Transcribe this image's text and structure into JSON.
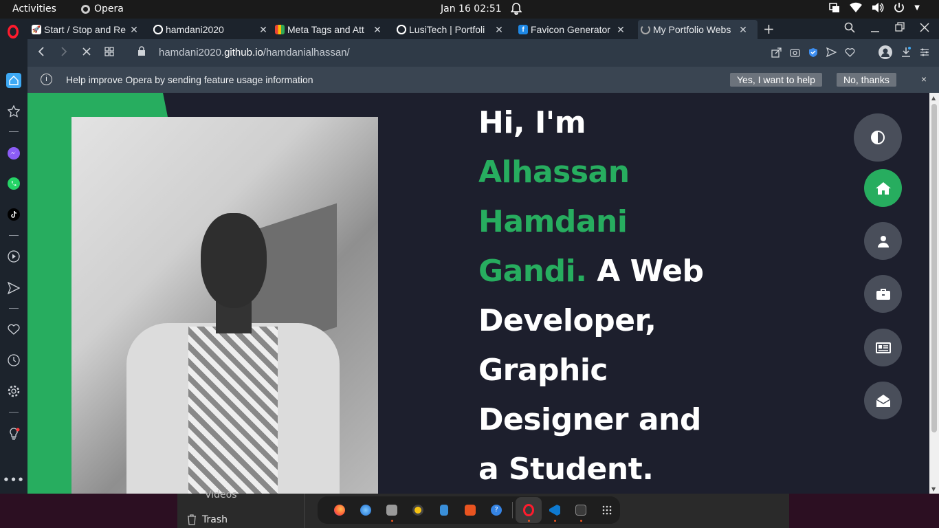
{
  "topbar": {
    "activities": "Activities",
    "app_name": "Opera",
    "clock": "Jan 16  02:51"
  },
  "tabs": [
    {
      "title": "Start / Stop and Re",
      "icon": "rocket-icon",
      "active": false
    },
    {
      "title": "hamdani2020",
      "icon": "github-icon",
      "active": false
    },
    {
      "title": "Meta Tags and Att",
      "icon": "colorful-favicon-icon",
      "active": false
    },
    {
      "title": "LusiTech | Portfoli",
      "icon": "github-icon",
      "active": false
    },
    {
      "title": "Favicon Generator",
      "icon": "favicon-f-icon",
      "active": false
    },
    {
      "title": "My Portfolio Webs",
      "icon": "loading-icon",
      "active": true
    }
  ],
  "address_bar": {
    "url_prefix": "hamdani2020.",
    "url_domain": "github.io",
    "url_path": "/hamdanialhassan/"
  },
  "infobar": {
    "message": "Help improve Opera by sending feature usage information",
    "accept": "Yes, I want to help",
    "decline": "No, thanks",
    "close": "×"
  },
  "hero": {
    "greeting": "Hi, I'm",
    "name_line1": "Alhassan",
    "name_line2": "Hamdani",
    "name_line3": "Gandi.",
    "role_part1": "A Web",
    "role_part2": "Developer,",
    "role_part3": "Graphic",
    "role_part4": "Designer and",
    "role_part5": "a Student."
  },
  "page_nav": [
    "theme-toggle",
    "home",
    "about",
    "portfolio",
    "blogs",
    "contact"
  ],
  "files_panel": {
    "videos": "Videos",
    "trash": "Trash"
  },
  "colors": {
    "accent_green": "#27ad5f",
    "page_bg": "#1d1f2d",
    "chrome_bg": "#1c232c"
  }
}
